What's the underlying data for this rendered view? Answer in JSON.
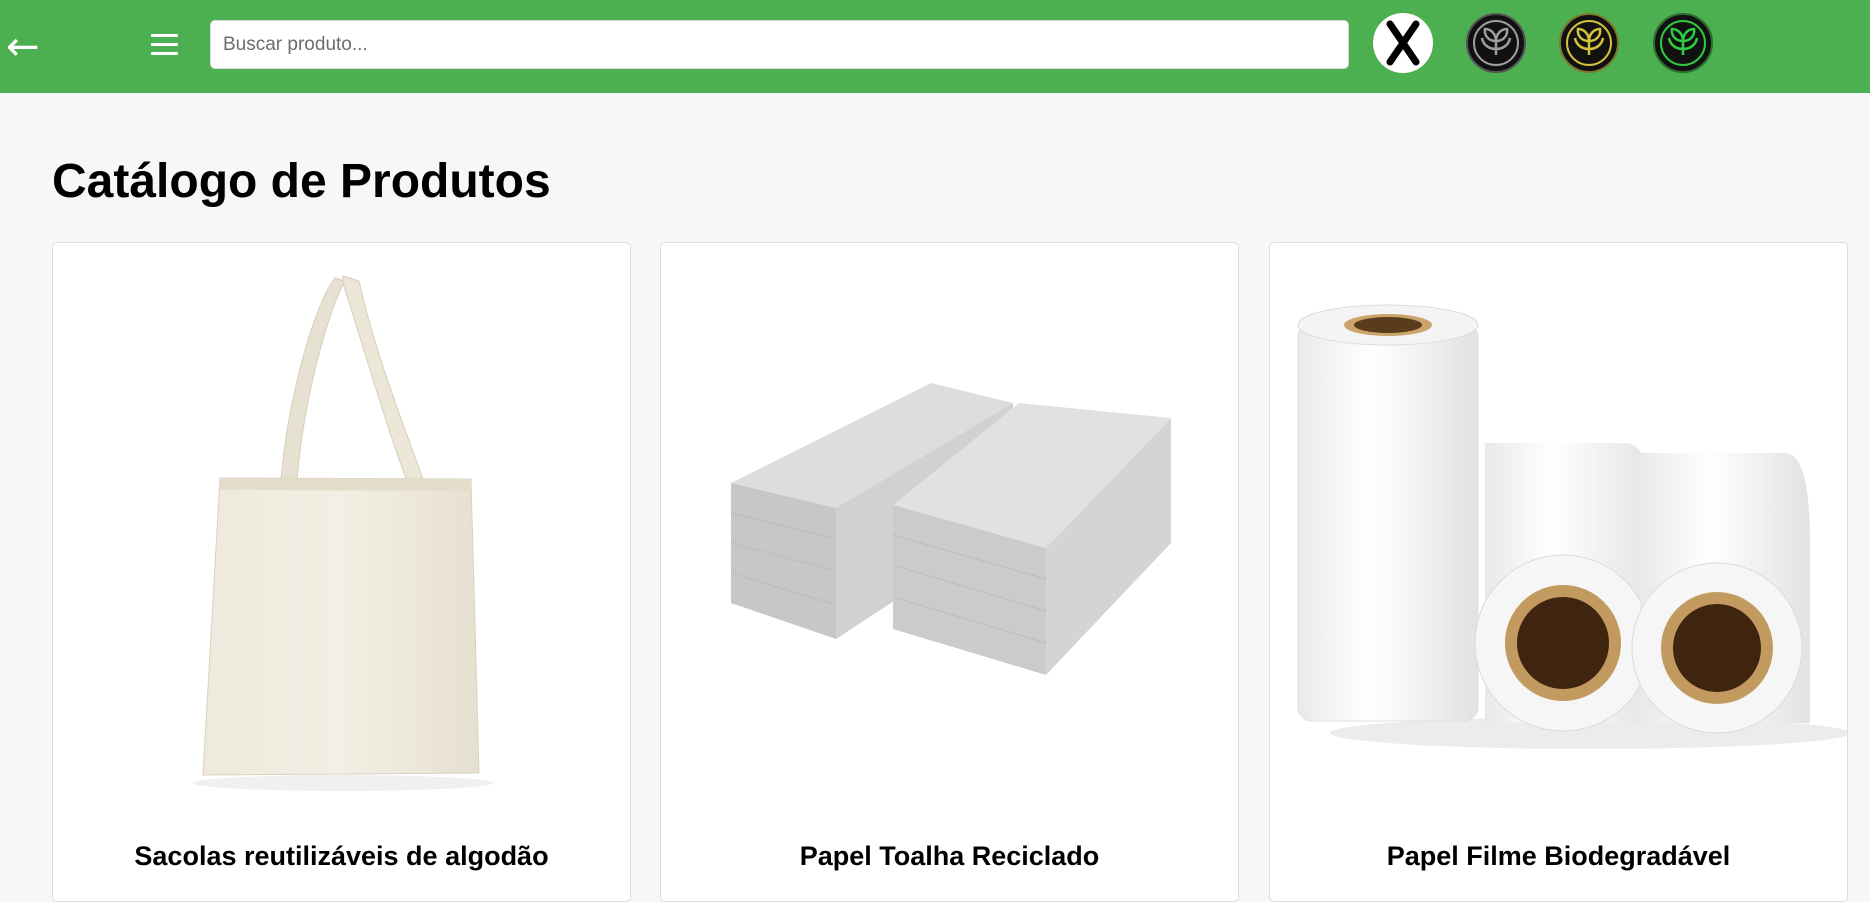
{
  "header": {
    "back_icon": "left-arrow-icon",
    "menu_icon": "hamburger-menu-icon",
    "search": {
      "placeholder": "Buscar produto...",
      "value": ""
    },
    "filters": [
      {
        "name": "no-filter",
        "icon": "x-icon",
        "color": "#000000"
      },
      {
        "name": "gray-leaf",
        "icon": "leaf-icon",
        "color": "#9e9e9e"
      },
      {
        "name": "yellow-leaf",
        "icon": "leaf-icon",
        "color": "#d4c33a"
      },
      {
        "name": "green-leaf",
        "icon": "leaf-icon",
        "color": "#2ecc40"
      }
    ],
    "background_color": "#4caf50"
  },
  "main": {
    "title": "Catálogo de Produtos",
    "products": [
      {
        "name": "Sacolas reutilizáveis de algodão",
        "image": "tote-bag"
      },
      {
        "name": "Papel Toalha Reciclado",
        "image": "paper-towel-stacks"
      },
      {
        "name": "Papel Filme Biodegradável",
        "image": "film-rolls"
      }
    ]
  }
}
